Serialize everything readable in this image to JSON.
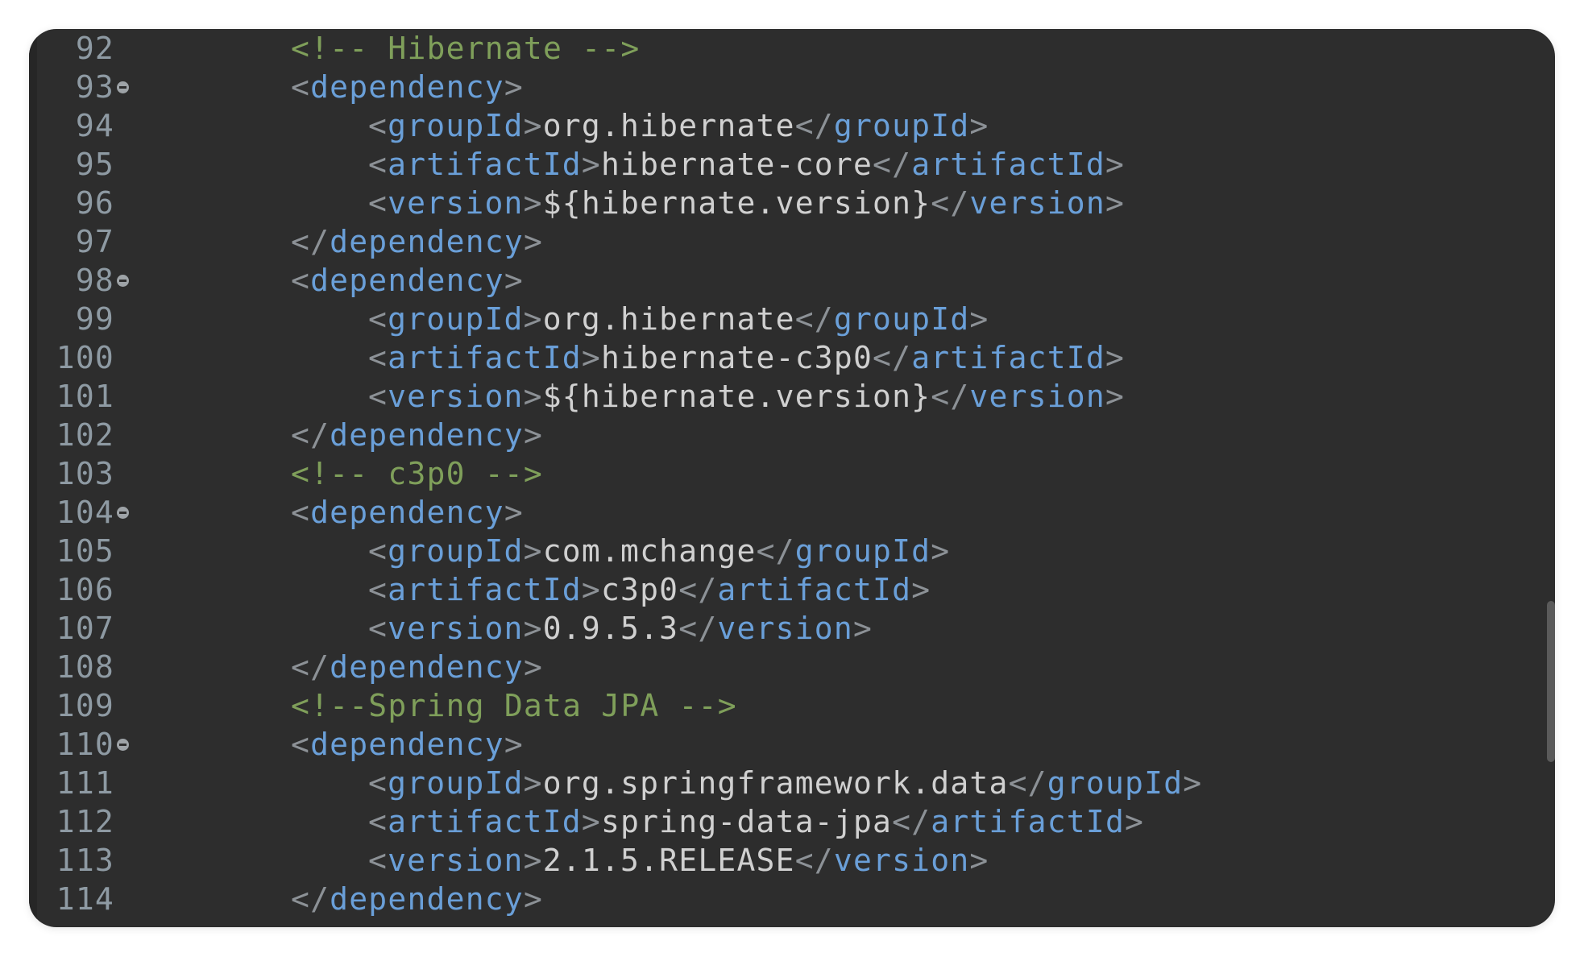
{
  "editor": {
    "lines": [
      {
        "num": "92",
        "fold": false,
        "indent": 0,
        "tokens": [
          {
            "t": "<!-- Hibernate -->",
            "k": "c"
          }
        ]
      },
      {
        "num": "93",
        "fold": true,
        "indent": 0,
        "tokens": [
          {
            "t": "<",
            "k": "b"
          },
          {
            "t": "dependency",
            "k": "n"
          },
          {
            "t": ">",
            "k": "b"
          }
        ]
      },
      {
        "num": "94",
        "fold": false,
        "indent": 1,
        "tokens": [
          {
            "t": "<",
            "k": "b"
          },
          {
            "t": "groupId",
            "k": "n"
          },
          {
            "t": ">",
            "k": "b"
          },
          {
            "t": "org.hibernate",
            "k": "t"
          },
          {
            "t": "</",
            "k": "b"
          },
          {
            "t": "groupId",
            "k": "n"
          },
          {
            "t": ">",
            "k": "b"
          }
        ]
      },
      {
        "num": "95",
        "fold": false,
        "indent": 1,
        "tokens": [
          {
            "t": "<",
            "k": "b"
          },
          {
            "t": "artifactId",
            "k": "n"
          },
          {
            "t": ">",
            "k": "b"
          },
          {
            "t": "hibernate-core",
            "k": "t"
          },
          {
            "t": "</",
            "k": "b"
          },
          {
            "t": "artifactId",
            "k": "n"
          },
          {
            "t": ">",
            "k": "b"
          }
        ]
      },
      {
        "num": "96",
        "fold": false,
        "indent": 1,
        "tokens": [
          {
            "t": "<",
            "k": "b"
          },
          {
            "t": "version",
            "k": "n"
          },
          {
            "t": ">",
            "k": "b"
          },
          {
            "t": "${hibernate.version}",
            "k": "t"
          },
          {
            "t": "</",
            "k": "b"
          },
          {
            "t": "version",
            "k": "n"
          },
          {
            "t": ">",
            "k": "b"
          }
        ]
      },
      {
        "num": "97",
        "fold": false,
        "indent": 0,
        "tokens": [
          {
            "t": "</",
            "k": "b"
          },
          {
            "t": "dependency",
            "k": "n"
          },
          {
            "t": ">",
            "k": "b"
          }
        ]
      },
      {
        "num": "98",
        "fold": true,
        "indent": 0,
        "tokens": [
          {
            "t": "<",
            "k": "b"
          },
          {
            "t": "dependency",
            "k": "n"
          },
          {
            "t": ">",
            "k": "b"
          }
        ]
      },
      {
        "num": "99",
        "fold": false,
        "indent": 1,
        "tokens": [
          {
            "t": "<",
            "k": "b"
          },
          {
            "t": "groupId",
            "k": "n"
          },
          {
            "t": ">",
            "k": "b"
          },
          {
            "t": "org.hibernate",
            "k": "t"
          },
          {
            "t": "</",
            "k": "b"
          },
          {
            "t": "groupId",
            "k": "n"
          },
          {
            "t": ">",
            "k": "b"
          }
        ]
      },
      {
        "num": "100",
        "fold": false,
        "indent": 1,
        "tokens": [
          {
            "t": "<",
            "k": "b"
          },
          {
            "t": "artifactId",
            "k": "n"
          },
          {
            "t": ">",
            "k": "b"
          },
          {
            "t": "hibernate-c3p0",
            "k": "t"
          },
          {
            "t": "</",
            "k": "b"
          },
          {
            "t": "artifactId",
            "k": "n"
          },
          {
            "t": ">",
            "k": "b"
          }
        ]
      },
      {
        "num": "101",
        "fold": false,
        "indent": 1,
        "tokens": [
          {
            "t": "<",
            "k": "b"
          },
          {
            "t": "version",
            "k": "n"
          },
          {
            "t": ">",
            "k": "b"
          },
          {
            "t": "${hibernate.version}",
            "k": "t"
          },
          {
            "t": "</",
            "k": "b"
          },
          {
            "t": "version",
            "k": "n"
          },
          {
            "t": ">",
            "k": "b"
          }
        ]
      },
      {
        "num": "102",
        "fold": false,
        "indent": 0,
        "tokens": [
          {
            "t": "</",
            "k": "b"
          },
          {
            "t": "dependency",
            "k": "n"
          },
          {
            "t": ">",
            "k": "b"
          }
        ]
      },
      {
        "num": "103",
        "fold": false,
        "indent": 0,
        "tokens": [
          {
            "t": "<!-- c3p0 -->",
            "k": "c"
          }
        ]
      },
      {
        "num": "104",
        "fold": true,
        "indent": 0,
        "tokens": [
          {
            "t": "<",
            "k": "b"
          },
          {
            "t": "dependency",
            "k": "n"
          },
          {
            "t": ">",
            "k": "b"
          }
        ]
      },
      {
        "num": "105",
        "fold": false,
        "indent": 1,
        "tokens": [
          {
            "t": "<",
            "k": "b"
          },
          {
            "t": "groupId",
            "k": "n"
          },
          {
            "t": ">",
            "k": "b"
          },
          {
            "t": "com.mchange",
            "k": "t"
          },
          {
            "t": "</",
            "k": "b"
          },
          {
            "t": "groupId",
            "k": "n"
          },
          {
            "t": ">",
            "k": "b"
          }
        ]
      },
      {
        "num": "106",
        "fold": false,
        "indent": 1,
        "tokens": [
          {
            "t": "<",
            "k": "b"
          },
          {
            "t": "artifactId",
            "k": "n"
          },
          {
            "t": ">",
            "k": "b"
          },
          {
            "t": "c3p0",
            "k": "t"
          },
          {
            "t": "</",
            "k": "b"
          },
          {
            "t": "artifactId",
            "k": "n"
          },
          {
            "t": ">",
            "k": "b"
          }
        ]
      },
      {
        "num": "107",
        "fold": false,
        "indent": 1,
        "tokens": [
          {
            "t": "<",
            "k": "b"
          },
          {
            "t": "version",
            "k": "n"
          },
          {
            "t": ">",
            "k": "b"
          },
          {
            "t": "0.9.5.3",
            "k": "t"
          },
          {
            "t": "</",
            "k": "b"
          },
          {
            "t": "version",
            "k": "n"
          },
          {
            "t": ">",
            "k": "b"
          }
        ]
      },
      {
        "num": "108",
        "fold": false,
        "indent": 0,
        "tokens": [
          {
            "t": "</",
            "k": "b"
          },
          {
            "t": "dependency",
            "k": "n"
          },
          {
            "t": ">",
            "k": "b"
          }
        ]
      },
      {
        "num": "109",
        "fold": false,
        "indent": 0,
        "tokens": [
          {
            "t": "<!--Spring Data JPA -->",
            "k": "c"
          }
        ]
      },
      {
        "num": "110",
        "fold": true,
        "indent": 0,
        "tokens": [
          {
            "t": "<",
            "k": "b"
          },
          {
            "t": "dependency",
            "k": "n"
          },
          {
            "t": ">",
            "k": "b"
          }
        ]
      },
      {
        "num": "111",
        "fold": false,
        "indent": 1,
        "tokens": [
          {
            "t": "<",
            "k": "b"
          },
          {
            "t": "groupId",
            "k": "n"
          },
          {
            "t": ">",
            "k": "b"
          },
          {
            "t": "org.springframework.data",
            "k": "t"
          },
          {
            "t": "</",
            "k": "b"
          },
          {
            "t": "groupId",
            "k": "n"
          },
          {
            "t": ">",
            "k": "b"
          }
        ]
      },
      {
        "num": "112",
        "fold": false,
        "indent": 1,
        "tokens": [
          {
            "t": "<",
            "k": "b"
          },
          {
            "t": "artifactId",
            "k": "n"
          },
          {
            "t": ">",
            "k": "b"
          },
          {
            "t": "spring-data-jpa",
            "k": "t"
          },
          {
            "t": "</",
            "k": "b"
          },
          {
            "t": "artifactId",
            "k": "n"
          },
          {
            "t": ">",
            "k": "b"
          }
        ]
      },
      {
        "num": "113",
        "fold": false,
        "indent": 1,
        "tokens": [
          {
            "t": "<",
            "k": "b"
          },
          {
            "t": "version",
            "k": "n"
          },
          {
            "t": ">",
            "k": "b"
          },
          {
            "t": "2.1.5.RELEASE",
            "k": "t"
          },
          {
            "t": "</",
            "k": "b"
          },
          {
            "t": "version",
            "k": "n"
          },
          {
            "t": ">",
            "k": "b"
          }
        ]
      },
      {
        "num": "114",
        "fold": false,
        "indent": 0,
        "tokens": [
          {
            "t": "</",
            "k": "b"
          },
          {
            "t": "dependency",
            "k": "n"
          },
          {
            "t": ">",
            "k": "b"
          }
        ]
      }
    ],
    "colors": {
      "background": "#2d2d2d",
      "line_number": "#8e9aa3",
      "tag_bracket": "#8c9196",
      "tag_name": "#6a9fd8",
      "text": "#d0d0d0",
      "comment": "#7f9f5a"
    },
    "icons": {
      "fold": "fold-collapse-icon"
    }
  }
}
